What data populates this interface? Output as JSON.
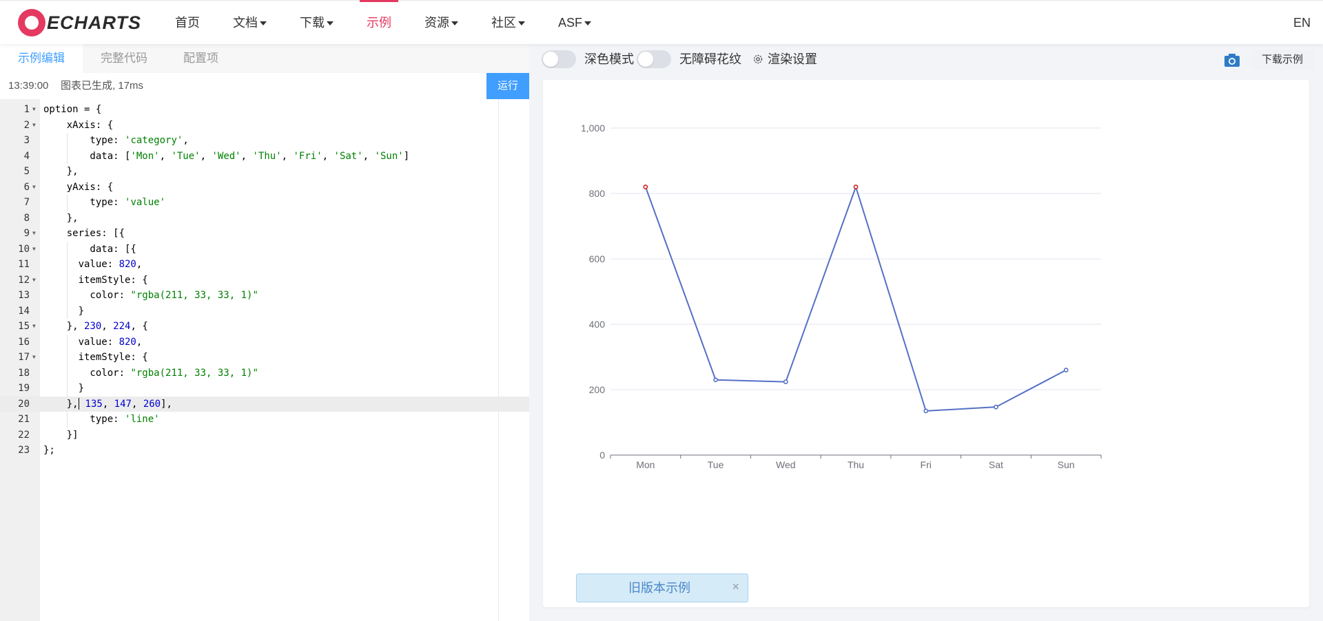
{
  "navbar": {
    "logo_text": "ECHARTS",
    "items": [
      {
        "label": "首页",
        "dropdown": false
      },
      {
        "label": "文档",
        "dropdown": true
      },
      {
        "label": "下载",
        "dropdown": true
      },
      {
        "label": "示例",
        "dropdown": false,
        "active": true
      },
      {
        "label": "资源",
        "dropdown": true
      },
      {
        "label": "社区",
        "dropdown": true
      },
      {
        "label": "ASF",
        "dropdown": true
      }
    ],
    "lang": "EN",
    "accent_color": "#e43961"
  },
  "editor_panel": {
    "tabs": [
      {
        "label": "示例编辑",
        "active": true
      },
      {
        "label": "完整代码",
        "active": false
      },
      {
        "label": "配置项",
        "active": false
      }
    ],
    "status": {
      "time": "13:39:00",
      "message": "图表已生成, 17ms"
    },
    "run_label": "运行",
    "active_line": 20,
    "lines": [
      {
        "n": "1",
        "fold": true,
        "text": "option = {"
      },
      {
        "n": "2",
        "fold": true,
        "text": "    xAxis: {"
      },
      {
        "n": "3",
        "fold": false,
        "text": "        type: 'category',"
      },
      {
        "n": "4",
        "fold": false,
        "text": "        data: ['Mon', 'Tue', 'Wed', 'Thu', 'Fri', 'Sat', 'Sun']"
      },
      {
        "n": "5",
        "fold": false,
        "text": "    },"
      },
      {
        "n": "6",
        "fold": true,
        "text": "    yAxis: {"
      },
      {
        "n": "7",
        "fold": false,
        "text": "        type: 'value'"
      },
      {
        "n": "8",
        "fold": false,
        "text": "    },"
      },
      {
        "n": "9",
        "fold": true,
        "text": "    series: [{"
      },
      {
        "n": "10",
        "fold": true,
        "text": "        data: [{"
      },
      {
        "n": "11",
        "fold": false,
        "text": "      value: 820,"
      },
      {
        "n": "12",
        "fold": true,
        "text": "      itemStyle: {"
      },
      {
        "n": "13",
        "fold": false,
        "text": "        color: \"rgba(211, 33, 33, 1)\""
      },
      {
        "n": "14",
        "fold": false,
        "text": "      }"
      },
      {
        "n": "15",
        "fold": true,
        "text": "    }, 230, 224, {"
      },
      {
        "n": "16",
        "fold": false,
        "text": "      value: 820,"
      },
      {
        "n": "17",
        "fold": true,
        "text": "      itemStyle: {"
      },
      {
        "n": "18",
        "fold": false,
        "text": "        color: \"rgba(211, 33, 33, 1)\""
      },
      {
        "n": "19",
        "fold": false,
        "text": "      }"
      },
      {
        "n": "20",
        "fold": false,
        "text": "    }, 135, 147, 260],"
      },
      {
        "n": "21",
        "fold": false,
        "text": "        type: 'line'"
      },
      {
        "n": "22",
        "fold": false,
        "text": "    }]"
      },
      {
        "n": "23",
        "fold": false,
        "text": "};"
      }
    ]
  },
  "preview_panel": {
    "dark_mode_label": "深色模式",
    "aria_label": "无障碍花纹",
    "render_settings_label": "渲染设置",
    "download_label": "下载示例",
    "old_version_label": "旧版本示例",
    "close_glyph": "×"
  },
  "chart_data": {
    "type": "line",
    "categories": [
      "Mon",
      "Tue",
      "Wed",
      "Thu",
      "Fri",
      "Sat",
      "Sun"
    ],
    "series": [
      {
        "values": [
          820,
          230,
          224,
          820,
          135,
          147,
          260
        ],
        "color": "#5470c6",
        "highlight_indices": [
          0,
          3
        ],
        "highlight_color": "#d32121"
      }
    ],
    "ylim": [
      0,
      1000
    ],
    "yticks": [
      0,
      200,
      400,
      600,
      800,
      1000
    ],
    "ytick_labels": [
      "0",
      "200",
      "400",
      "600",
      "800",
      "1,000"
    ],
    "grid": true,
    "legend": "none"
  }
}
